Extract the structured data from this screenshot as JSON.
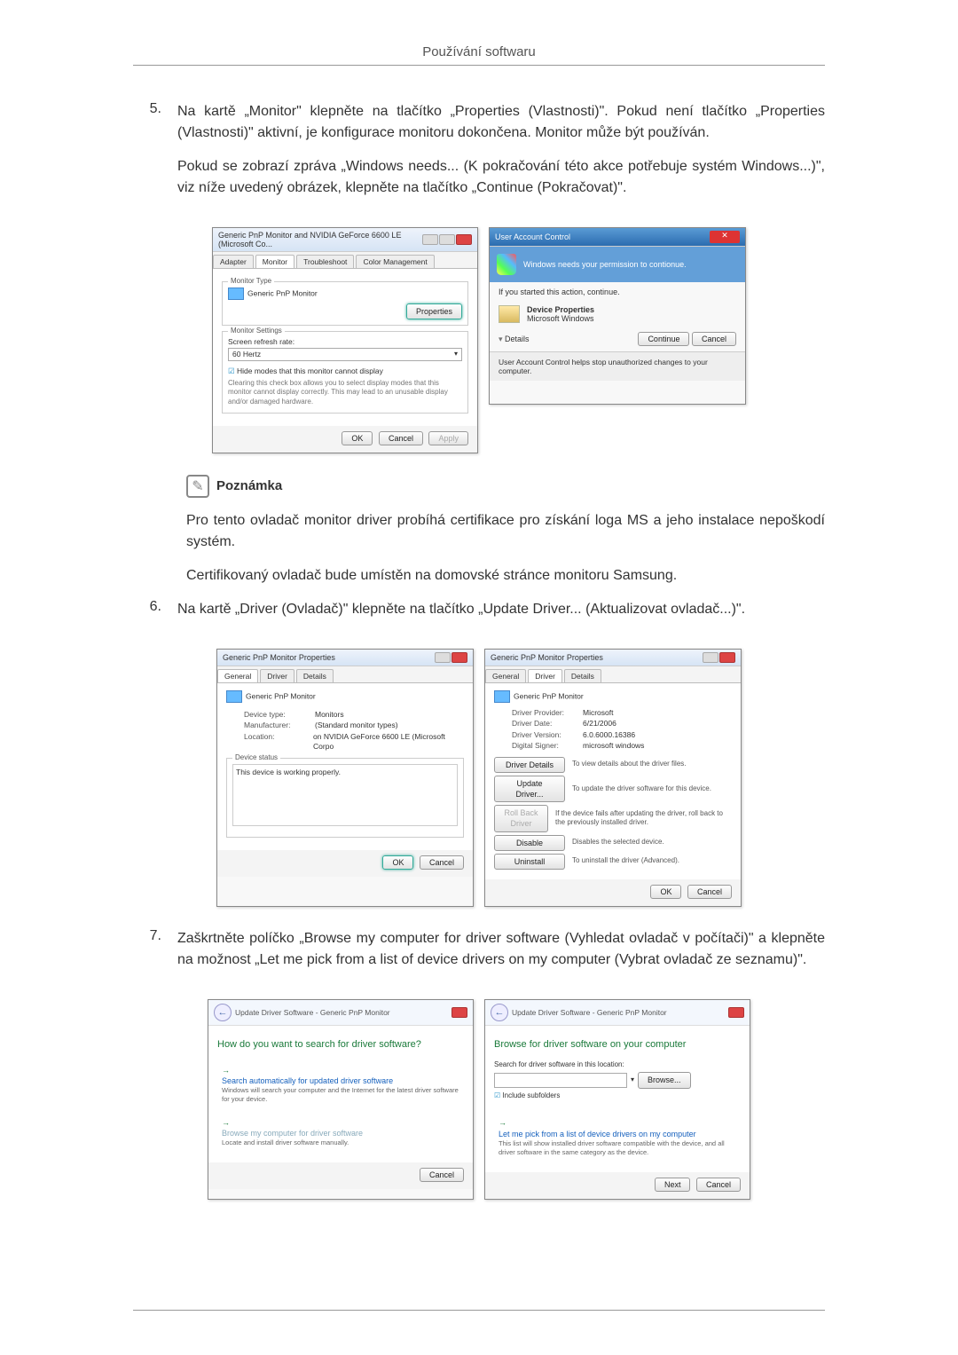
{
  "header": "Používání softwaru",
  "steps": {
    "s5": {
      "num": "5.",
      "p1": "Na kartě „Monitor\" klepněte na tlačítko „Properties (Vlastnosti)\". Pokud není tlačítko „Properties (Vlastnosti)\" aktivní, je konfigurace monitoru dokončena. Monitor může být používán.",
      "p2": "Pokud se zobrazí zpráva „Windows needs... (K pokračování této akce potřebuje systém Windows...)\", viz níže uvedený obrázek, klepněte na tlačítko „Continue (Pokračovat)\"."
    },
    "s6": {
      "num": "6.",
      "p1": "Na kartě „Driver (Ovladač)\" klepněte na tlačítko „Update Driver... (Aktualizovat ovladač...)\"."
    },
    "s7": {
      "num": "7.",
      "p1": "Zaškrtněte políčko „Browse my computer for driver software (Vyhledat ovladač v počítači)\" a klepněte na možnost „Let me pick from a list of device drivers on my computer (Vybrat ovladač ze seznamu)\"."
    }
  },
  "note": {
    "label": "Poznámka",
    "p1": "Pro tento ovladač monitor driver probíhá certifikace pro získání loga MS a jeho instalace nepoškodí systém.",
    "p2": "Certifikovaný ovladač bude umístěn na domovské stránce monitoru Samsung."
  },
  "fig1": {
    "title": "Generic PnP Monitor and NVIDIA GeForce 6600 LE (Microsoft Co...",
    "tabs": {
      "adapter": "Adapter",
      "monitor": "Monitor",
      "troubleshoot": "Troubleshoot",
      "color": "Color Management"
    },
    "mtype_legend": "Monitor Type",
    "mtype_value": "Generic PnP Monitor",
    "properties_btn": "Properties",
    "msettings_legend": "Monitor Settings",
    "refresh_label": "Screen refresh rate:",
    "refresh_value": "60 Hertz",
    "hide_modes": "Hide modes that this monitor cannot display",
    "hide_desc": "Clearing this check box allows you to select display modes that this monitor cannot display correctly. This may lead to an unusable display and/or damaged hardware.",
    "ok": "OK",
    "cancel": "Cancel",
    "apply": "Apply"
  },
  "uac": {
    "title": "User Account Control",
    "banner": "Windows needs your permission to contionue.",
    "sub": "If you started this action, continue.",
    "item_name": "Device Properties",
    "item_pub": "Microsoft Windows",
    "details": "Details",
    "continue": "Continue",
    "cancel": "Cancel",
    "foot": "User Account Control helps stop unauthorized changes to your computer."
  },
  "fig2a": {
    "title": "Generic PnP Monitor Properties",
    "tabs": {
      "general": "General",
      "driver": "Driver",
      "details": "Details"
    },
    "name": "Generic PnP Monitor",
    "devtype_k": "Device type:",
    "devtype_v": "Monitors",
    "manu_k": "Manufacturer:",
    "manu_v": "(Standard monitor types)",
    "loc_k": "Location:",
    "loc_v": "on NVIDIA GeForce 6600 LE (Microsoft Corpo",
    "status_legend": "Device status",
    "status_text": "This device is working properly.",
    "ok": "OK",
    "cancel": "Cancel"
  },
  "fig2b": {
    "title": "Generic PnP Monitor Properties",
    "tabs": {
      "general": "General",
      "driver": "Driver",
      "details": "Details"
    },
    "name": "Generic PnP Monitor",
    "prov_k": "Driver Provider:",
    "prov_v": "Microsoft",
    "date_k": "Driver Date:",
    "date_v": "6/21/2006",
    "ver_k": "Driver Version:",
    "ver_v": "6.0.6000.16386",
    "sign_k": "Digital Signer:",
    "sign_v": "microsoft windows",
    "b_details": "Driver Details",
    "b_details_d": "To view details about the driver files.",
    "b_update": "Update Driver...",
    "b_update_d": "To update the driver software for this device.",
    "b_roll": "Roll Back Driver",
    "b_roll_d": "If the device fails after updating the driver, roll back to the previously installed driver.",
    "b_disable": "Disable",
    "b_disable_d": "Disables the selected device.",
    "b_uninstall": "Uninstall",
    "b_uninstall_d": "To uninstall the driver (Advanced).",
    "ok": "OK",
    "cancel": "Cancel"
  },
  "fig3a": {
    "crumb": "Update Driver Software - Generic PnP Monitor",
    "q": "How do you want to search for driver software?",
    "opt1_t": "Search automatically for updated driver software",
    "opt1_d": "Windows will search your computer and the Internet for the latest driver software for your device.",
    "opt2_t": "Browse my computer for driver software",
    "opt2_d": "Locate and install driver software manually.",
    "cancel": "Cancel"
  },
  "fig3b": {
    "crumb": "Update Driver Software - Generic PnP Monitor",
    "q": "Browse for driver software on your computer",
    "path_label": "Search for driver software in this location:",
    "browse": "Browse...",
    "include": "Include subfolders",
    "opt_t": "Let me pick from a list of device drivers on my computer",
    "opt_d": "This list will show installed driver software compatible with the device, and all driver software in the same category as the device.",
    "next": "Next",
    "cancel": "Cancel"
  }
}
